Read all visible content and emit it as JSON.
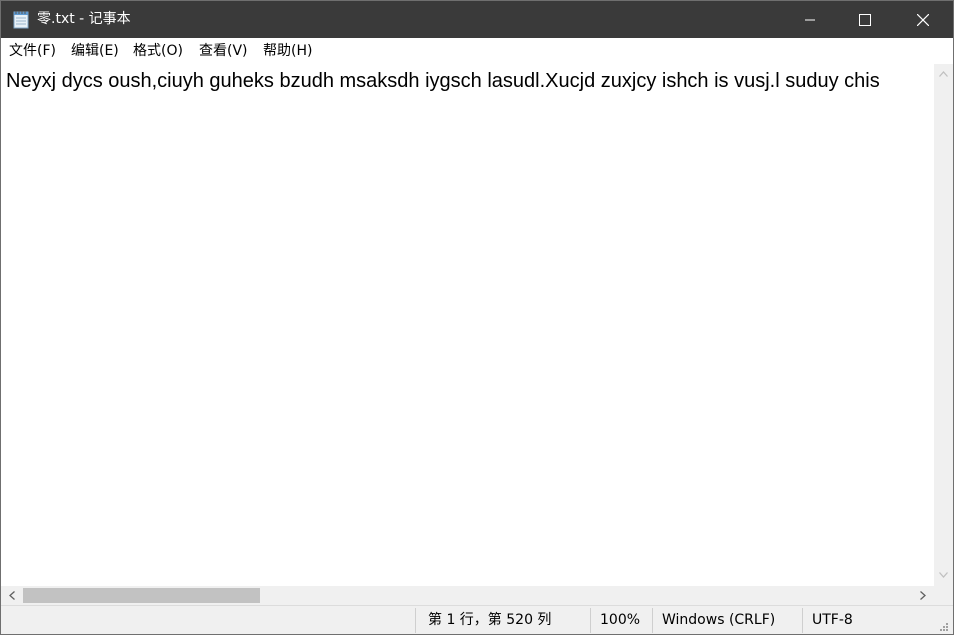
{
  "window": {
    "title": "零.txt - 记事本",
    "app_icon": "notepad-icon",
    "controls": {
      "minimize": "minimize-icon",
      "maximize": "maximize-icon",
      "close": "close-icon"
    }
  },
  "menu": [
    {
      "label": "文件(F)"
    },
    {
      "label": "编辑(E)"
    },
    {
      "label": "格式(O)"
    },
    {
      "label": "查看(V)"
    },
    {
      "label": "帮助(H)"
    }
  ],
  "editor": {
    "content": "Neyxj dycs oush,ciuyh guheks bzudh msaksdh iygsch lasudl.Xucjd zuxjcy ishch is vusj.l suduy chis"
  },
  "scrollbars": {
    "horizontal_position": 0.0,
    "left_arrow": "chevron-left-icon",
    "right_arrow": "chevron-right-icon",
    "up_arrow": "chevron-up-icon",
    "down_arrow": "chevron-down-icon"
  },
  "status": {
    "position": "第 1 行，第 520 列",
    "zoom": "100%",
    "line_ending": "Windows (CRLF)",
    "encoding": "UTF-8"
  },
  "colors": {
    "titlebar": "#3a3a3a",
    "chrome": "#f0f0f0",
    "scroll_thumb": "#c2c2c2"
  }
}
